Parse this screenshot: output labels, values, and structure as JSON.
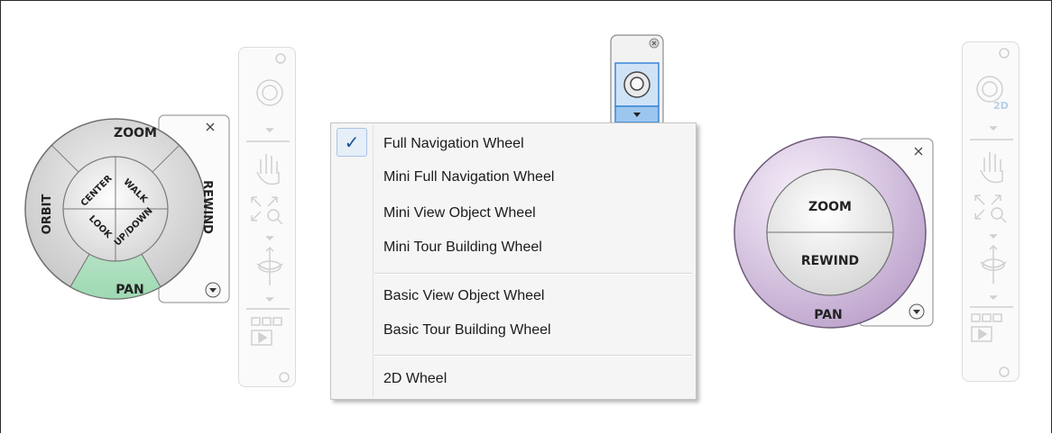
{
  "full_wheel": {
    "zoom": "ZOOM",
    "orbit": "ORBIT",
    "rewind": "REWIND",
    "center": "CENTER",
    "walk": "WALK",
    "look": "LOOK",
    "updown": "UP/DOWN",
    "pan": "PAN",
    "close_icon": "close-icon",
    "menu_icon": "chevron-down-icon",
    "highlight_color": "#b8e3c6"
  },
  "basic_wheel": {
    "zoom": "ZOOM",
    "rewind": "REWIND",
    "pan": "PAN",
    "ring_color": "#d8c7e2"
  },
  "left_navbar": {
    "badge": "",
    "icons": [
      "close-icon",
      "steering-wheel-icon",
      "chevron-down-icon",
      "hand-pan-icon",
      "zoom-extents-icon",
      "chevron-down-icon",
      "orbit-icon",
      "chevron-down-icon",
      "showmotion-icon",
      "minimize-icon"
    ]
  },
  "right_navbar": {
    "badge": "2D",
    "icons": [
      "close-icon",
      "steering-wheel-2d-icon",
      "chevron-down-icon",
      "hand-pan-icon",
      "zoom-extents-icon",
      "chevron-down-icon",
      "orbit-icon",
      "chevron-down-icon",
      "showmotion-icon",
      "minimize-icon"
    ]
  },
  "menu": {
    "check": "✓",
    "group1": [
      "Full Navigation Wheel",
      "Mini Full Navigation Wheel",
      "Mini View Object Wheel",
      "Mini Tour Building Wheel"
    ],
    "group2": [
      "Basic View Object Wheel",
      "Basic Tour Building Wheel"
    ],
    "group3": [
      "2D Wheel"
    ]
  },
  "colors": {
    "selected_blue": "#3a86d8",
    "frame": "#2a2a2a"
  }
}
